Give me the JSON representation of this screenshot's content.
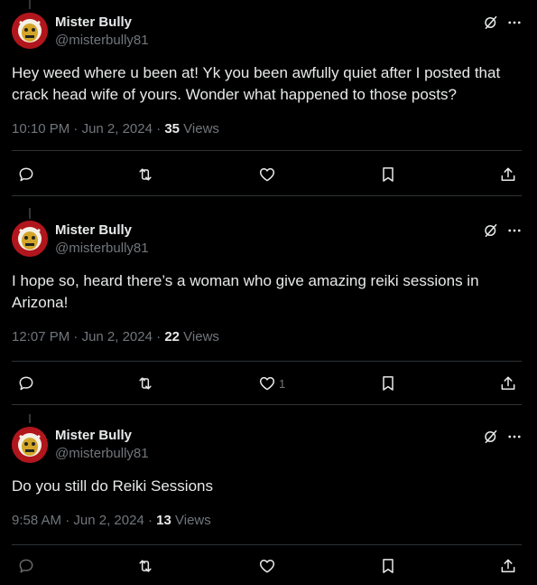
{
  "tweets": [
    {
      "name": "Mister Bully",
      "handle": "@misterbully81",
      "text": "Hey weed where u been at! Yk you been awfully quiet after I posted that crack head wife of yours. Wonder what happened to those posts?",
      "time": "10:10 PM",
      "date": "Jun 2, 2024",
      "views_count": "35",
      "views_label": "Views",
      "likes": ""
    },
    {
      "name": "Mister Bully",
      "handle": "@misterbully81",
      "text": "I hope so, heard there’s a woman who give amazing reiki sessions in Arizona!",
      "time": "12:07 PM",
      "date": "Jun 2, 2024",
      "views_count": "22",
      "views_label": "Views",
      "likes": "1"
    },
    {
      "name": "Mister Bully",
      "handle": "@misterbully81",
      "text": "Do you still do Reiki Sessions",
      "time": "9:58 AM",
      "date": "Jun 2, 2024",
      "views_count": "13",
      "views_label": "Views",
      "likes": ""
    }
  ],
  "separator": " · ",
  "colors": {
    "background": "#000000",
    "text": "#e7e9ea",
    "muted": "#71767b",
    "divider": "#2f3336",
    "avatar": "#b0161c"
  },
  "icons": [
    "grok-icon",
    "more-icon",
    "reply-icon",
    "retweet-icon",
    "like-icon",
    "bookmark-icon",
    "share-icon"
  ]
}
